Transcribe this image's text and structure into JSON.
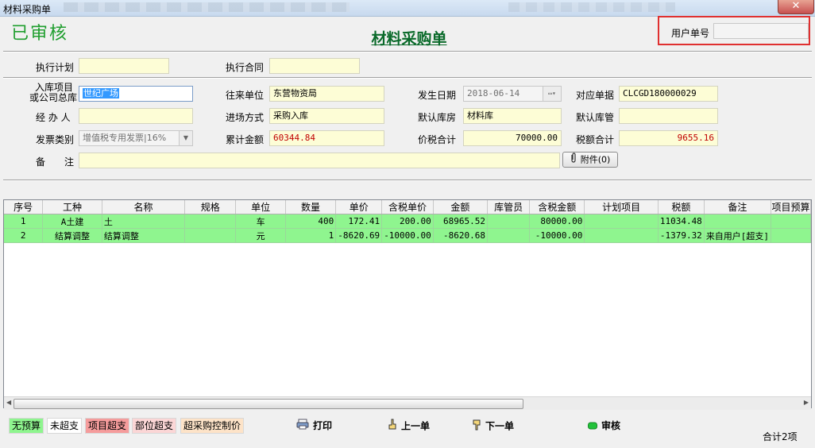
{
  "window": {
    "title": "材料采购单",
    "close_glyph": "✕"
  },
  "header": {
    "status": "已审核",
    "doc_title": "材料采购单",
    "user_no_label": "用户单号",
    "user_no_value": ""
  },
  "form": {
    "exec_plan_label": "执行计划",
    "exec_plan_value": "",
    "exec_contract_label": "执行合同",
    "exec_contract_value": "",
    "project_label_line1": "入库项目",
    "project_label_line2": "或公司总库",
    "project_value": "世纪广场",
    "partner_label": "往来单位",
    "partner_value": "东营物资局",
    "date_label": "发生日期",
    "date_value": "2018-06-14",
    "ref_label": "对应单据",
    "ref_value": "CLCGD180000029",
    "handler_label": "经 办 人",
    "handler_value": "",
    "entry_label": "进场方式",
    "entry_value": "采购入库",
    "warehouse_label": "默认库房",
    "warehouse_value": "材料库",
    "keeper_label": "默认库管",
    "keeper_value": "",
    "invoice_label": "发票类别",
    "invoice_value": "增值税专用发票|16%",
    "total_label": "累计金额",
    "total_value": "60344.84",
    "taxincl_label": "价税合计",
    "taxincl_value": "70000.00",
    "tax_label": "税额合计",
    "tax_value": "9655.16",
    "remark_label": "备　　注",
    "remark_value": "",
    "attach_label": "附件(0)"
  },
  "table": {
    "columns": [
      "序号",
      "工种",
      "名称",
      "规格",
      "单位",
      "数量",
      "单价",
      "含税单价",
      "金额",
      "库管员",
      "含税金额",
      "计划项目",
      "税额",
      "备注",
      "项目预算"
    ],
    "rows": [
      [
        "1",
        "A土建",
        "土",
        "",
        "车",
        "400",
        "172.41",
        "200.00",
        "68965.52",
        "",
        "80000.00",
        "",
        "11034.48",
        "",
        ""
      ],
      [
        "2",
        "结算调整",
        "结算调整",
        "",
        "元",
        "1",
        "-8620.69",
        "-10000.00",
        "-8620.68",
        "",
        "-10000.00",
        "",
        "-1379.32",
        "来自用户[超支]",
        ""
      ]
    ]
  },
  "legend": [
    {
      "label": "无预算",
      "color": "#8ff58f"
    },
    {
      "label": "未超支",
      "color": "#ffffff"
    },
    {
      "label": "项目超支",
      "color": "#f59c9c"
    },
    {
      "label": "部位超支",
      "color": "#fbd6d6"
    },
    {
      "label": "超采购控制价",
      "color": "#fde3c8"
    }
  ],
  "actions": {
    "print": "打印",
    "prev": "上一单",
    "next": "下一单",
    "audit": "审核"
  },
  "footer": {
    "count": "合计2项"
  },
  "colors": {
    "accent_green": "#1f9e2e",
    "row_green": "#8ff58f",
    "field_yellow": "#fdfdd6",
    "highlight_red": "#e03030"
  }
}
